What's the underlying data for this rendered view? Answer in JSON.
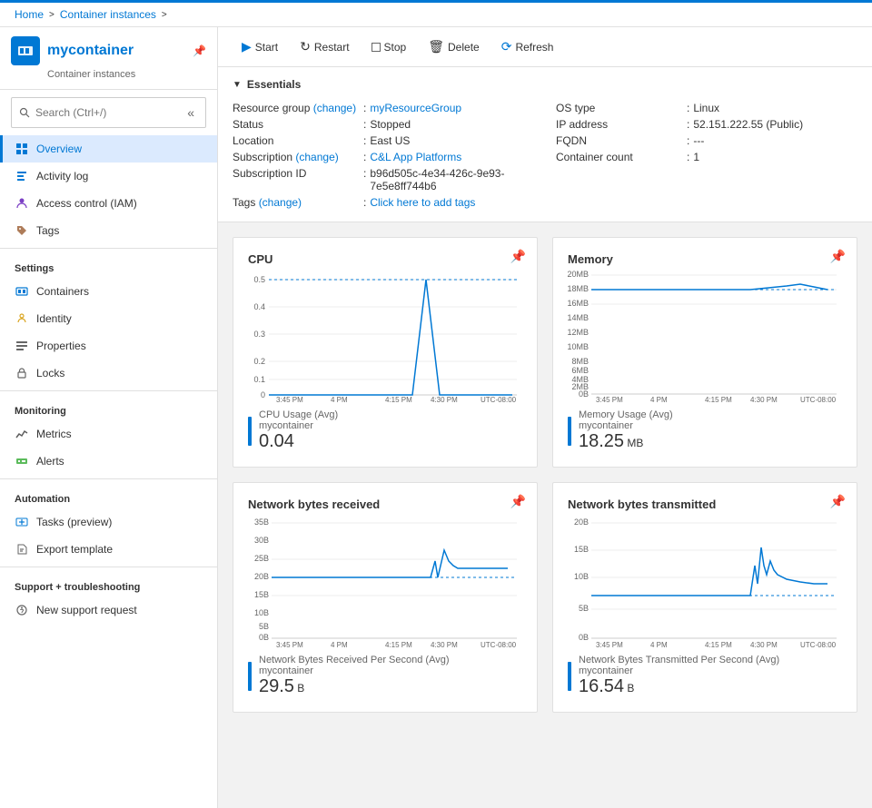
{
  "breadcrumb": {
    "home": "Home",
    "container_instances": "Container instances",
    "sep1": ">",
    "sep2": ">"
  },
  "sidebar": {
    "container_name": "mycontainer",
    "container_subtitle": "Container instances",
    "search_placeholder": "Search (Ctrl+/)",
    "collapse_label": "«",
    "nav_items": [
      {
        "id": "overview",
        "label": "Overview",
        "icon": "overview",
        "active": true,
        "section": ""
      },
      {
        "id": "activity-log",
        "label": "Activity log",
        "icon": "activity",
        "active": false,
        "section": ""
      },
      {
        "id": "access-control",
        "label": "Access control (IAM)",
        "icon": "iam",
        "active": false,
        "section": ""
      },
      {
        "id": "tags",
        "label": "Tags",
        "icon": "tags",
        "active": false,
        "section": ""
      }
    ],
    "sections": [
      {
        "label": "Settings",
        "items": [
          {
            "id": "containers",
            "label": "Containers",
            "icon": "containers"
          },
          {
            "id": "identity",
            "label": "Identity",
            "icon": "identity"
          },
          {
            "id": "properties",
            "label": "Properties",
            "icon": "properties"
          },
          {
            "id": "locks",
            "label": "Locks",
            "icon": "locks"
          }
        ]
      },
      {
        "label": "Monitoring",
        "items": [
          {
            "id": "metrics",
            "label": "Metrics",
            "icon": "metrics"
          },
          {
            "id": "alerts",
            "label": "Alerts",
            "icon": "alerts"
          }
        ]
      },
      {
        "label": "Automation",
        "items": [
          {
            "id": "tasks",
            "label": "Tasks (preview)",
            "icon": "tasks"
          },
          {
            "id": "export",
            "label": "Export template",
            "icon": "export"
          }
        ]
      },
      {
        "label": "Support + troubleshooting",
        "items": [
          {
            "id": "new-support",
            "label": "New support request",
            "icon": "support"
          }
        ]
      }
    ]
  },
  "toolbar": {
    "start_label": "Start",
    "restart_label": "Restart",
    "stop_label": "Stop",
    "delete_label": "Delete",
    "refresh_label": "Refresh"
  },
  "essentials": {
    "header": "Essentials",
    "fields_left": [
      {
        "label": "Resource group (change)",
        "value": "myResourceGroup",
        "link": true
      },
      {
        "label": "Status",
        "value": "Stopped"
      },
      {
        "label": "Location",
        "value": "East US"
      },
      {
        "label": "Subscription (change)",
        "value": "C&L App Platforms",
        "link": true
      },
      {
        "label": "Subscription ID",
        "value": "b96d505c-4e34-426c-9e93-7e5e8ff744b6"
      },
      {
        "label": "Tags (change)",
        "value": "Click here to add tags",
        "link": true
      }
    ],
    "fields_right": [
      {
        "label": "OS type",
        "value": "Linux"
      },
      {
        "label": "IP address",
        "value": "52.151.222.55 (Public)"
      },
      {
        "label": "FQDN",
        "value": "---"
      },
      {
        "label": "Container count",
        "value": "1"
      }
    ]
  },
  "charts": [
    {
      "id": "cpu",
      "title": "CPU",
      "legend_label": "CPU Usage (Avg)",
      "legend_sublabel": "mycontainer",
      "value": "0.04",
      "unit": "",
      "type": "cpu"
    },
    {
      "id": "memory",
      "title": "Memory",
      "legend_label": "Memory Usage (Avg)",
      "legend_sublabel": "mycontainer",
      "value": "18.25",
      "unit": "MB",
      "type": "memory"
    },
    {
      "id": "network-recv",
      "title": "Network bytes received",
      "legend_label": "Network Bytes Received Per Second (Avg)",
      "legend_sublabel": "mycontainer",
      "value": "29.5",
      "unit": "B",
      "type": "network-recv"
    },
    {
      "id": "network-trans",
      "title": "Network bytes transmitted",
      "legend_label": "Network Bytes Transmitted Per Second (Avg)",
      "legend_sublabel": "mycontainer",
      "value": "16.54",
      "unit": "B",
      "type": "network-trans"
    }
  ],
  "time_labels": [
    "3:45 PM",
    "4 PM",
    "4:15 PM",
    "4:30 PM",
    "UTC-08:00"
  ]
}
